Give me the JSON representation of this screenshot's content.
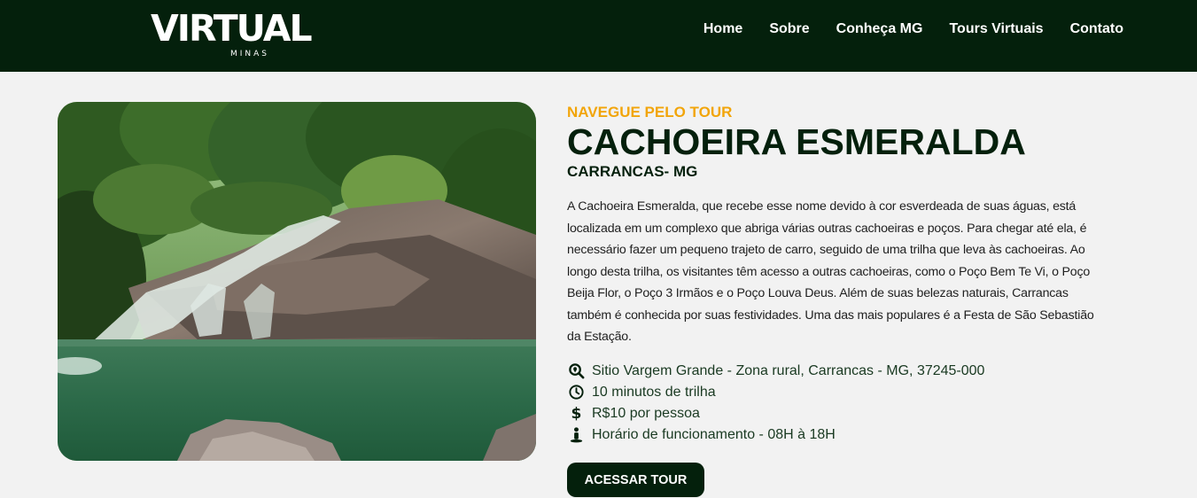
{
  "brand": {
    "logo_word": "VIRTUAL",
    "logo_sub": "MINAS"
  },
  "nav": {
    "items": [
      "Home",
      "Sobre",
      "Conheça MG",
      "Tours Virtuais",
      "Contato"
    ]
  },
  "hero_image": {
    "alt": "Cachoeira Esmeralda"
  },
  "tour": {
    "eyebrow": "NAVEGUE PELO TOUR",
    "title": "CACHOEIRA ESMERALDA",
    "subtitle": "CARRANCAS- MG",
    "description": "A Cachoeira Esmeralda, que recebe esse nome devido à cor esverdeada de suas águas, está localizada em um complexo que abriga várias outras cachoeiras e poços. Para chegar até ela, é necessário fazer um pequeno trajeto de carro, seguido de uma trilha que leva às cachoeiras. Ao longo desta trilha, os visitantes têm acesso a outras cachoeiras, como o Poço Bem Te Vi, o Poço Beija Flor, o Poço 3 Irmãos e o Poço Louva Deus. Além de suas belezas naturais, Carrancas também é conhecida por suas festividades. Uma das mais populares é a Festa de São Sebastião da Estação.",
    "info": [
      {
        "icon": "location-search-icon",
        "text": "Sitio Vargem Grande - Zona rural, Carrancas - MG, 37245-000"
      },
      {
        "icon": "clock-icon",
        "text": "10 minutos de trilha"
      },
      {
        "icon": "dollar-icon",
        "text": "R$10 por pessoa"
      },
      {
        "icon": "person-location-icon",
        "text": "Horário de funcionamento - 08H à 18H"
      }
    ],
    "cta": "ACESSAR TOUR"
  },
  "colors": {
    "header_bg": "#04200c",
    "accent": "#f2a50a",
    "page_bg": "#f2f2f2",
    "button_bg": "#04200c"
  }
}
